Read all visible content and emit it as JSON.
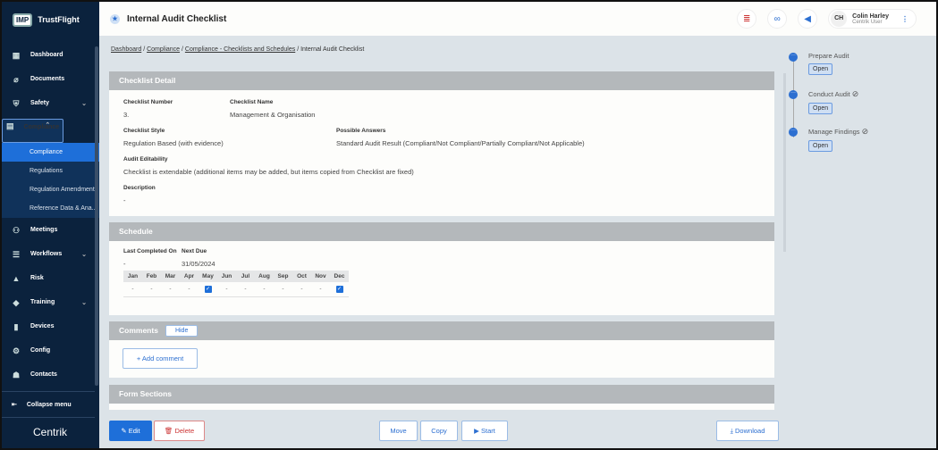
{
  "app": {
    "logo_badge": "IMP",
    "brand": "TrustFlight",
    "footer_logo": "Centrik"
  },
  "sidebar": {
    "items": [
      {
        "label": "Dashboard",
        "icon": "dashboard-icon"
      },
      {
        "label": "Documents",
        "icon": "paperclip-icon"
      },
      {
        "label": "Safety",
        "icon": "shield-icon"
      },
      {
        "label": "Compliance",
        "icon": "compliance-icon"
      },
      {
        "label": "Meetings",
        "icon": "meetings-icon"
      },
      {
        "label": "Workflows",
        "icon": "workflows-icon"
      },
      {
        "label": "Risk",
        "icon": "risk-icon"
      },
      {
        "label": "Training",
        "icon": "training-icon"
      },
      {
        "label": "Devices",
        "icon": "devices-icon"
      },
      {
        "label": "Config",
        "icon": "config-icon"
      },
      {
        "label": "Contacts",
        "icon": "contacts-icon"
      }
    ],
    "sub_items": [
      "Compliance",
      "Regulations",
      "Regulation Amendments",
      "Reference Data & Ana..."
    ],
    "collapse": "Collapse menu"
  },
  "header": {
    "title": "Internal Audit Checklist",
    "user_initials": "CH",
    "user_name": "Colin Harley",
    "user_role": "Centrik User"
  },
  "breadcrumb": [
    "Dashboard",
    "Compliance",
    "Compliance - Checklists and Schedules",
    "Internal Audit Checklist"
  ],
  "detail": {
    "title": "Checklist Detail",
    "number_label": "Checklist Number",
    "number": "3.",
    "name_label": "Checklist Name",
    "name": "Management & Organisation",
    "style_label": "Checklist Style",
    "style": "Regulation Based (with evidence)",
    "answers_label": "Possible Answers",
    "answers": "Standard Audit Result (Compliant/Not Compliant/Partially Compliant/Not Applicable)",
    "edit_label": "Audit Editability",
    "edit": "Checklist is extendable (additional items may be added, but items copied from Checklist are fixed)",
    "desc_label": "Description",
    "desc": "-"
  },
  "schedule": {
    "title": "Schedule",
    "last_label": "Last Completed On",
    "last": "-",
    "next_label": "Next Due",
    "next": "31/05/2024",
    "months": [
      "Jan",
      "Feb",
      "Mar",
      "Apr",
      "May",
      "Jun",
      "Jul",
      "Aug",
      "Sep",
      "Oct",
      "Nov",
      "Dec"
    ],
    "checked": [
      false,
      false,
      false,
      false,
      true,
      false,
      false,
      false,
      false,
      false,
      false,
      true
    ]
  },
  "comments": {
    "title": "Comments",
    "hide": "Hide",
    "add": "Add comment"
  },
  "form_sections": {
    "title": "Form Sections"
  },
  "actions": {
    "edit": "Edit",
    "delete": "Delete",
    "move": "Move",
    "copy": "Copy",
    "start": "Start",
    "download": "Download"
  },
  "workflow": {
    "steps": [
      {
        "name": "Prepare Audit",
        "blocked": false
      },
      {
        "name": "Conduct Audit",
        "blocked": true
      },
      {
        "name": "Manage Findings",
        "blocked": true
      }
    ],
    "open": "Open"
  }
}
